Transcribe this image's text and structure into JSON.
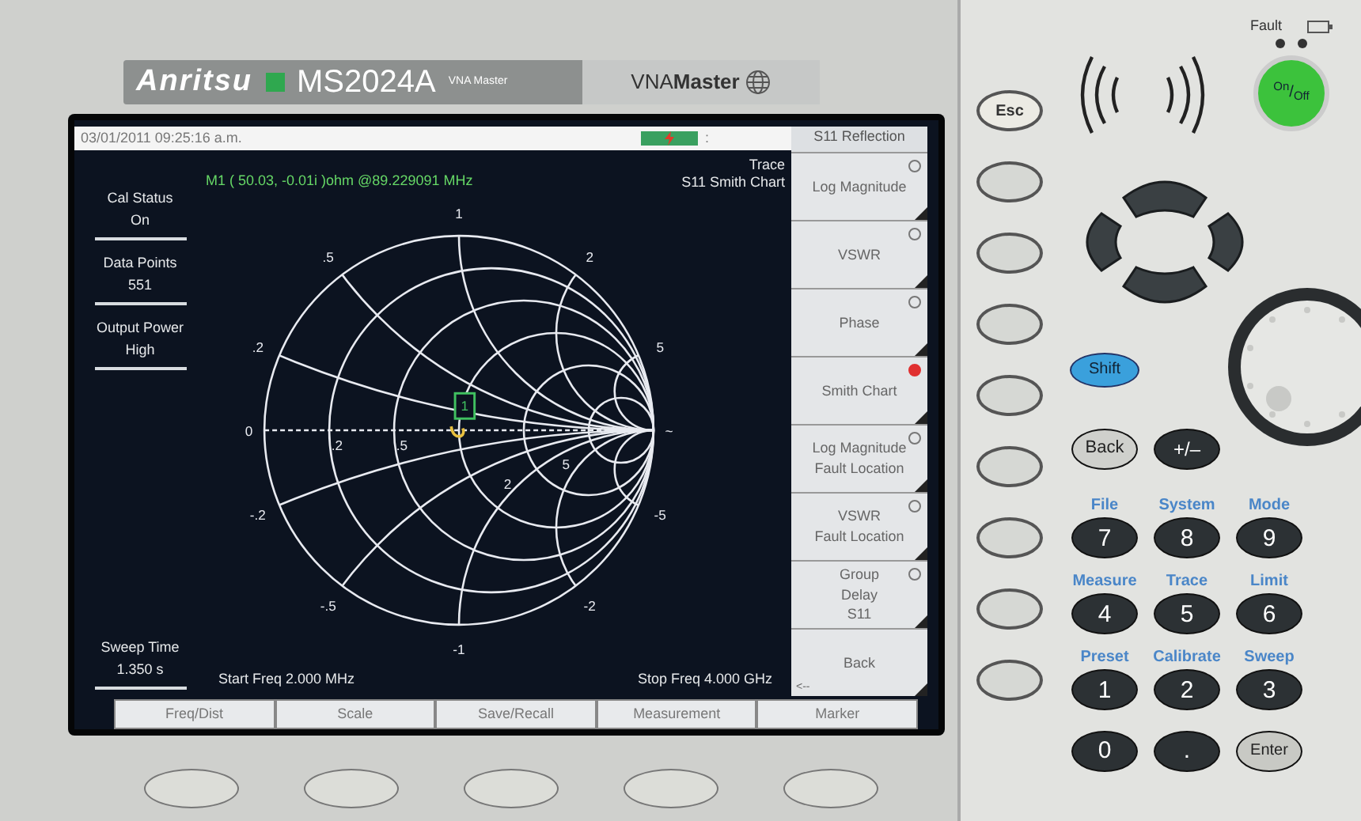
{
  "device": {
    "brand": "Anritsu",
    "model": "MS2024A",
    "model_subtitle": "VNA Master",
    "product_logo": "VNA**Master**"
  },
  "screen": {
    "status_bar": {
      "datetime": "03/01/2011 09:25:16 a.m.",
      "separator": ":"
    },
    "info_panel": [
      {
        "label": "Cal Status",
        "value": "On"
      },
      {
        "label": "Data Points",
        "value": "551"
      },
      {
        "label": "Output Power",
        "value": "High"
      }
    ],
    "sweep_time": {
      "label": "Sweep Time",
      "value": "1.350 s"
    },
    "marker_readout": "M1 ( 50.03, -0.01i )ohm @89.229091 MHz",
    "trace_label": "Trace",
    "trace_name": "S11 Smith Chart",
    "chart_labels": [
      "1",
      ".5",
      "2",
      ".2",
      "5",
      "0",
      ".2",
      ".5",
      "2",
      "5",
      "~",
      "-.2",
      "-5",
      "-.5",
      "-2",
      "-1"
    ],
    "marker_label": "1",
    "start_freq": "Start Freq 2.000 MHz",
    "stop_freq": "Stop Freq 4.000 GHz",
    "menu": {
      "title": "S11 Reflection",
      "items": [
        {
          "kind": "radio",
          "lines": [
            "Log Magnitude"
          ],
          "selected": false
        },
        {
          "kind": "radio",
          "lines": [
            "VSWR"
          ],
          "selected": false
        },
        {
          "kind": "radio",
          "lines": [
            "Phase"
          ],
          "selected": false
        },
        {
          "kind": "radio",
          "lines": [
            "Smith Chart"
          ],
          "selected": true
        },
        {
          "kind": "radio",
          "lines": [
            "Log Magnitude",
            "Fault Location"
          ],
          "selected": false
        },
        {
          "kind": "radio",
          "lines": [
            "VSWR",
            "Fault Location"
          ],
          "selected": false
        },
        {
          "kind": "radio",
          "lines": [
            "Group",
            "Delay",
            "S11"
          ],
          "selected": false
        },
        {
          "kind": "back",
          "lines": [
            "Back"
          ],
          "hint": "<--"
        }
      ]
    },
    "tabs": [
      "Freq/Dist",
      "Scale",
      "Save/Recall",
      "Measurement",
      "Marker"
    ]
  },
  "keypad": {
    "esc": "Esc",
    "fault": "Fault",
    "power": "$^{On}$/$_{Off}$",
    "shift": "Shift",
    "back": "Back",
    "sign": "+/–",
    "keys": [
      {
        "label": "File",
        "key": "7"
      },
      {
        "label": "System",
        "key": "8"
      },
      {
        "label": "Mode",
        "key": "9"
      },
      {
        "label": "Measure",
        "key": "4"
      },
      {
        "label": "Trace",
        "key": "5"
      },
      {
        "label": "Limit",
        "key": "6"
      },
      {
        "label": "Preset",
        "key": "1"
      },
      {
        "label": "Calibrate",
        "key": "2"
      },
      {
        "label": "Sweep",
        "key": "3"
      }
    ],
    "bottom_keys": [
      "0",
      ".",
      "Enter"
    ]
  }
}
